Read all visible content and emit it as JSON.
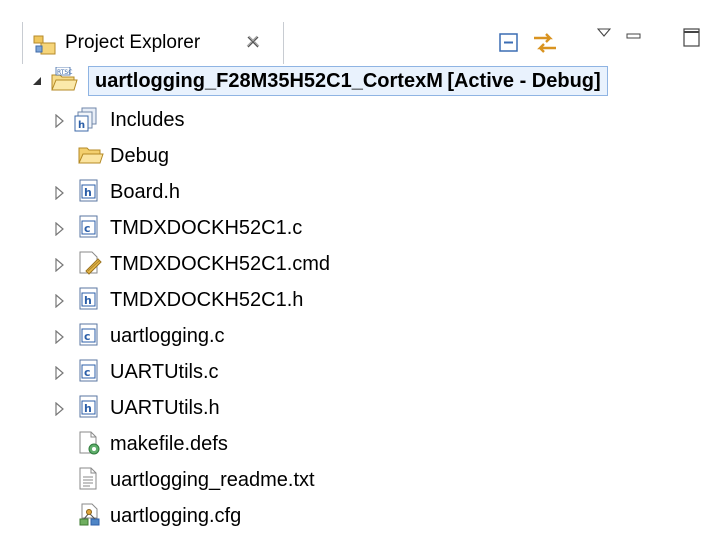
{
  "panel": {
    "title": "Project Explorer",
    "icons": {
      "view": "project-explorer-icon",
      "close": "close-tab-icon",
      "collapse": "collapse-all-icon",
      "link": "link-with-editor-icon",
      "menu": "view-menu-icon",
      "minimize": "minimize-icon",
      "maximize": "maximize-icon"
    }
  },
  "tree": {
    "project": {
      "name": "uartlogging_F28M35H52C1_CortexM",
      "status": "[Active - Debug]",
      "badge": "RTSC"
    },
    "items": [
      {
        "label": "Includes",
        "icon": "includes-icon",
        "expandable": true
      },
      {
        "label": "Debug",
        "icon": "folder-icon",
        "expandable": false
      },
      {
        "label": "Board.h",
        "icon": "h-file-icon",
        "expandable": true
      },
      {
        "label": "TMDXDOCKH52C1.c",
        "icon": "c-file-icon",
        "expandable": true
      },
      {
        "label": "TMDXDOCKH52C1.cmd",
        "icon": "cmd-file-icon",
        "expandable": true
      },
      {
        "label": "TMDXDOCKH52C1.h",
        "icon": "h-file-icon",
        "expandable": true
      },
      {
        "label": "uartlogging.c",
        "icon": "c-file-icon",
        "expandable": true
      },
      {
        "label": "UARTUtils.c",
        "icon": "c-file-icon",
        "expandable": true
      },
      {
        "label": "UARTUtils.h",
        "icon": "h-file-icon",
        "expandable": true
      },
      {
        "label": "makefile.defs",
        "icon": "makefile-icon",
        "expandable": false
      },
      {
        "label": "uartlogging_readme.txt",
        "icon": "text-file-icon",
        "expandable": false
      },
      {
        "label": "uartlogging.cfg",
        "icon": "cfg-file-icon",
        "expandable": false
      }
    ]
  },
  "colors": {
    "selection_border": "#8fb4e3",
    "selection_fill": "#e9f2fd",
    "folder": "#e7b54a",
    "file_icon_blue": "#2c5fa8"
  }
}
